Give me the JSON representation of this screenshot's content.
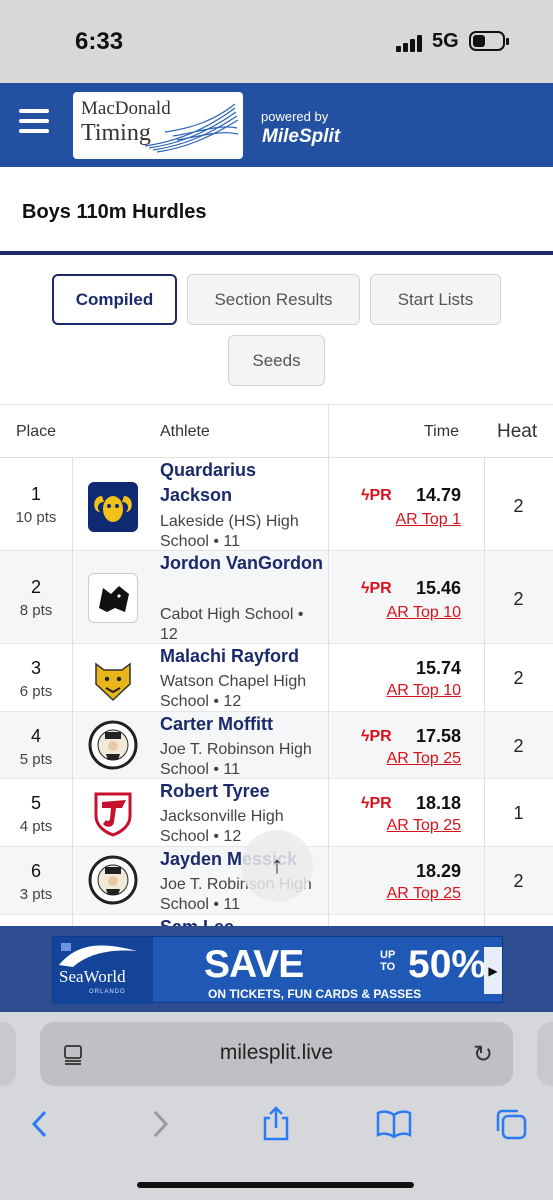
{
  "status_bar": {
    "time": "6:33",
    "network": "5G"
  },
  "header": {
    "logo_line1": "MacDonald",
    "logo_line2": "Timing",
    "powered_by": "powered by",
    "brand": "MileSplit"
  },
  "page_title": "Boys 110m Hurdles",
  "tabs": [
    "Compiled",
    "Section Results",
    "Start Lists",
    "Seeds"
  ],
  "active_tab": "Compiled",
  "table": {
    "headers": {
      "place": "Place",
      "athlete": "Athlete",
      "time": "Time",
      "heat": "Heat"
    },
    "rows": [
      {
        "place": "1",
        "points": "10 pts",
        "name": "Quardarius Jackson",
        "school": "Lakeside (HS) High School • 11",
        "pr": "PR",
        "time": "14.79",
        "rank": "AR Top 1",
        "heat": "2",
        "logo_icon": "ram-icon"
      },
      {
        "place": "2",
        "points": "8 pts",
        "name": "Jordon VanGordon",
        "school": "Cabot High School • 12",
        "pr": "PR",
        "time": "15.46",
        "rank": "AR Top 10",
        "heat": "2",
        "logo_icon": "panther-icon"
      },
      {
        "place": "3",
        "points": "6 pts",
        "name": "Malachi Rayford",
        "school": "Watson Chapel High School • 12",
        "pr": "",
        "time": "15.74",
        "rank": "AR Top 10",
        "heat": "2",
        "logo_icon": "wildcat-icon"
      },
      {
        "place": "4",
        "points": "5 pts",
        "name": "Carter Moffitt",
        "school": "Joe T. Robinson High School • 11",
        "pr": "PR",
        "time": "17.58",
        "rank": "AR Top 25",
        "heat": "2",
        "logo_icon": "senator-icon"
      },
      {
        "place": "5",
        "points": "4 pts",
        "name": "Robert Tyree",
        "school": "Jacksonville High School • 12",
        "pr": "PR",
        "time": "18.18",
        "rank": "AR Top 25",
        "heat": "1",
        "logo_icon": "j-shield-icon"
      },
      {
        "place": "6",
        "points": "3 pts",
        "name": "Jayden Messick",
        "school": "Joe T. Robinson High School • 11",
        "pr": "",
        "time": "18.29",
        "rank": "AR Top 25",
        "heat": "2",
        "logo_icon": "senator-icon"
      },
      {
        "place": "",
        "points": "",
        "name": "Sam Lee",
        "school": "",
        "pr": "",
        "time": "",
        "rank": "",
        "heat": "",
        "logo_icon": ""
      }
    ]
  },
  "ad": {
    "brand": "SeaWorld",
    "location": "ORLANDO",
    "headline": "SAVE",
    "up": "UP",
    "to": "TO",
    "percent": "50%",
    "subline": "ON TICKETS, FUN CARDS & PASSES"
  },
  "browser": {
    "url": "milesplit.live"
  },
  "colors": {
    "header_blue": "#2350a0",
    "navy": "#1b2a6b",
    "pr_red": "#d7131b"
  }
}
